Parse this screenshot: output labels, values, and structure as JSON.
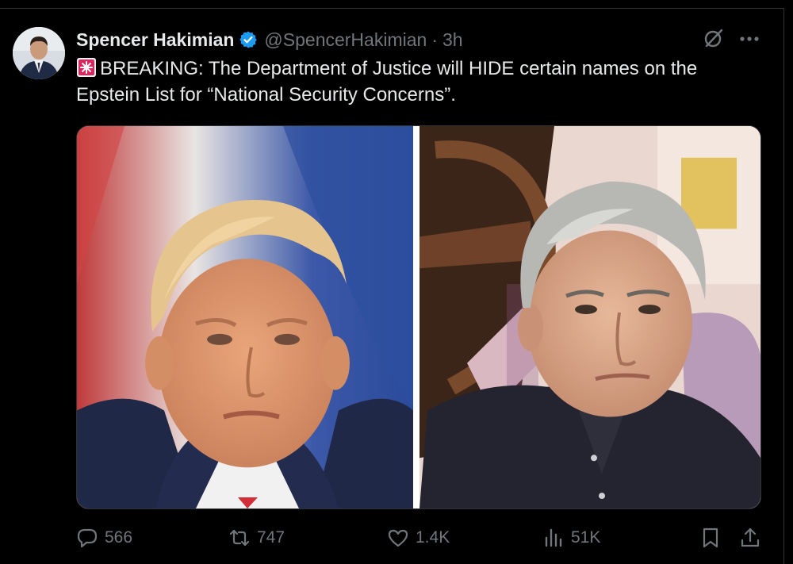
{
  "post": {
    "author_name": "Spencer Hakimian",
    "handle": "@SpencerHakimian",
    "separator": "·",
    "time": "3h",
    "text_emoji": "rotating-light-icon",
    "text_line1": "BREAKING: The Department of Justice will HIDE certain names on the",
    "text_line2": "Epstein List for “National Security Concerns”."
  },
  "actions": {
    "replies": "566",
    "reposts": "747",
    "likes": "1.4K",
    "views": "51K"
  },
  "icons": {
    "verified": "verified-badge-icon",
    "grok": "grok-icon",
    "more": "more-icon",
    "reply": "reply-icon",
    "repost": "repost-icon",
    "like": "heart-icon",
    "views": "views-icon",
    "bookmark": "bookmark-icon",
    "share": "share-icon"
  },
  "colors": {
    "background": "#000000",
    "text": "#e7e9ea",
    "secondary": "#71767b",
    "verified": "#1d9bf0",
    "siren": "#e0245e"
  }
}
